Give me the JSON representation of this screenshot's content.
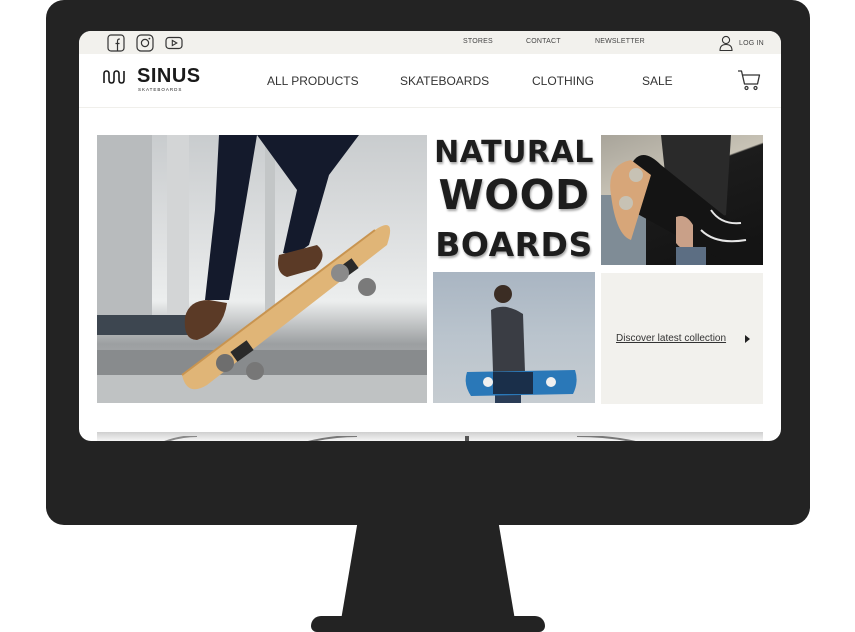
{
  "topbar": {
    "social_icons": [
      "facebook-icon",
      "instagram-icon",
      "youtube-icon"
    ],
    "links": {
      "stores": "STORES",
      "contact": "CONTACT",
      "newsletter": "NEWSLETTER"
    },
    "login": "LOG IN"
  },
  "header": {
    "logo_text": "SINUS",
    "logo_sub": "SKATEBOARDS",
    "nav": {
      "all_products": "ALL PRODUCTS",
      "skateboards": "SKATEBOARDS",
      "clothing": "CLOTHING",
      "sale": "SALE"
    },
    "cart_icon": "shopping-cart-icon"
  },
  "gallery": {
    "headline": [
      "NATURAL",
      "WOOD",
      "BOARDS"
    ],
    "discover_link": "Discover latest collection"
  },
  "colors": {
    "monitor": "#232323",
    "topbar_bg": "#f2f1ed",
    "text": "#333333"
  }
}
